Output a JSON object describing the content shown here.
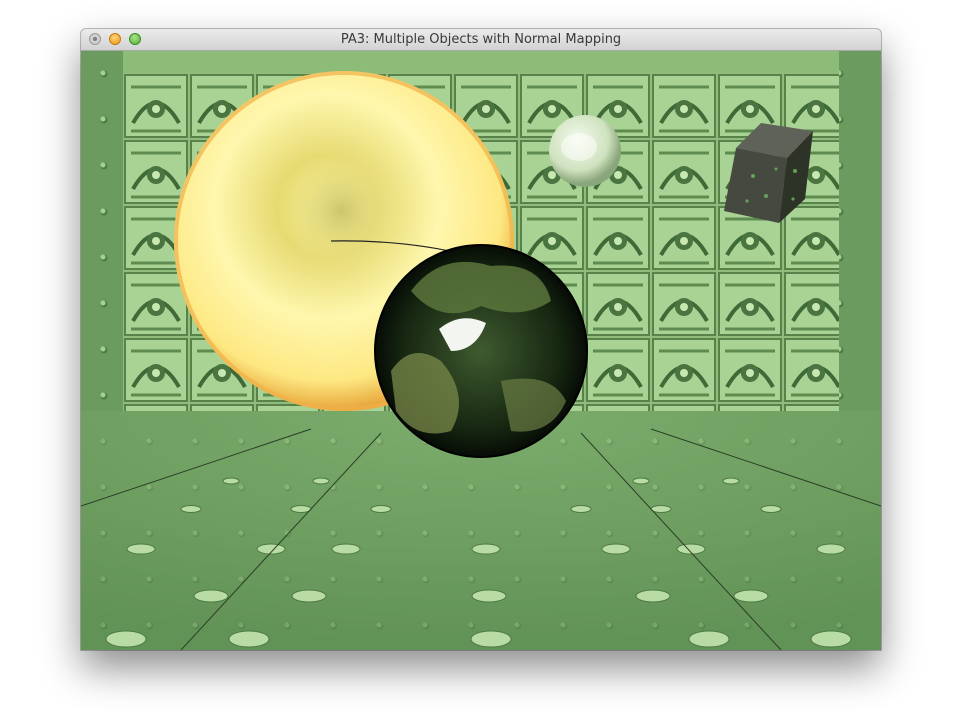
{
  "window": {
    "title": "PA3: Multiple Objects with Normal Mapping",
    "buttons": [
      "close",
      "minimize",
      "zoom"
    ]
  },
  "scene": {
    "objects": [
      "sun-sphere",
      "earth-sphere",
      "moon-sphere",
      "textured-cube",
      "floor",
      "back-wall",
      "side-walls"
    ],
    "colors": {
      "floor": "#6f9f62",
      "wall_tile": "#9ccb86",
      "sun": "#fff59a",
      "earth_dark": "#0d1a0c"
    }
  }
}
